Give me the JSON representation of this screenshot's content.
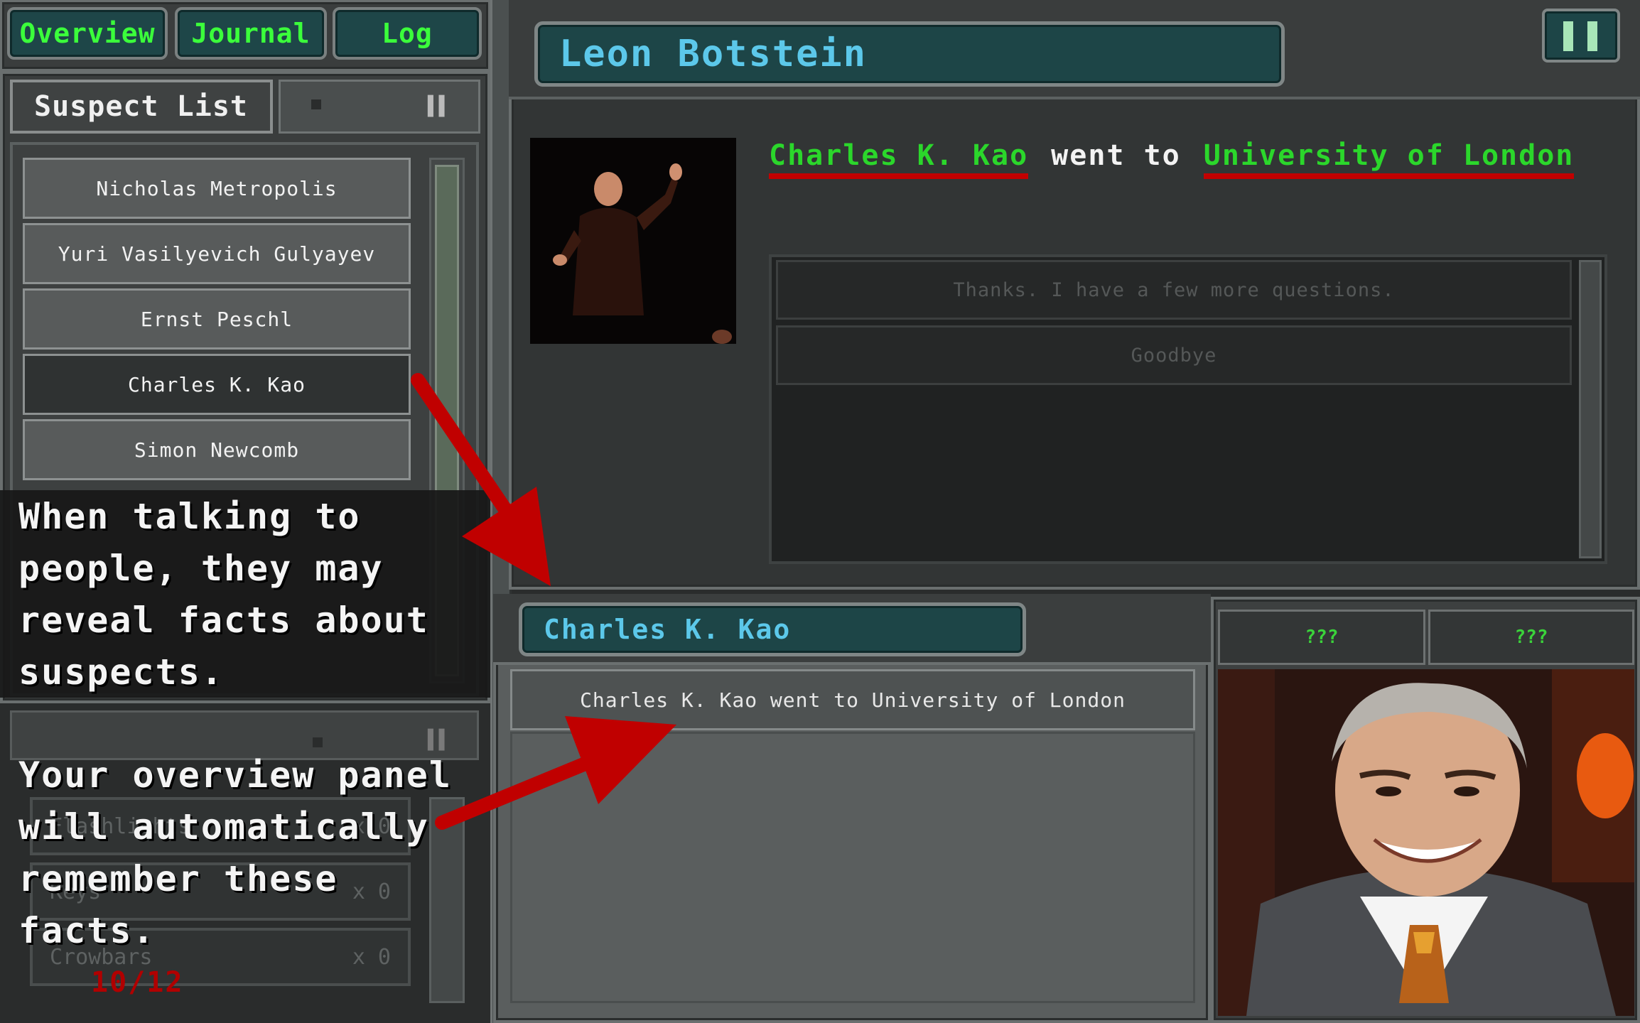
{
  "tabs": [
    {
      "label": "Overview"
    },
    {
      "label": "Journal"
    },
    {
      "label": "Log"
    }
  ],
  "suspect_list": {
    "title": "Suspect List",
    "items": [
      {
        "name": "Nicholas Metropolis"
      },
      {
        "name": "Yuri Vasilyevich Gulyayev"
      },
      {
        "name": "Ernst Peschl"
      },
      {
        "name": "Charles K. Kao",
        "selected": true
      },
      {
        "name": "Simon Newcomb"
      }
    ]
  },
  "inventory": {
    "items": [
      {
        "name": "Flashlights",
        "count": "x 0"
      },
      {
        "name": "Keys",
        "count": "x 0"
      },
      {
        "name": "Crowbars",
        "count": "x 0"
      }
    ],
    "counter": "10/12"
  },
  "tutorial": {
    "text1": "When talking to\npeople, they may\nreveal facts about\nsuspects.",
    "text2": "Your overview panel\nwill automatically\nremember these\nfacts."
  },
  "dialog": {
    "speaker": "Leon Botstein",
    "statement": {
      "subject": "Charles K. Kao",
      "verb": "went to",
      "place": "University of London"
    },
    "choices": [
      {
        "label": "Thanks. I have a few more questions."
      },
      {
        "label": "Goodbye"
      }
    ]
  },
  "suspect_panel": {
    "name": "Charles K. Kao",
    "facts": [
      {
        "text": "Charles K. Kao went to University of London"
      }
    ],
    "unknowns": [
      "???",
      "???"
    ]
  },
  "colors": {
    "accent_green": "#2bd72b",
    "name_blue": "#5cc8ea",
    "highlight_red": "#c20000"
  }
}
